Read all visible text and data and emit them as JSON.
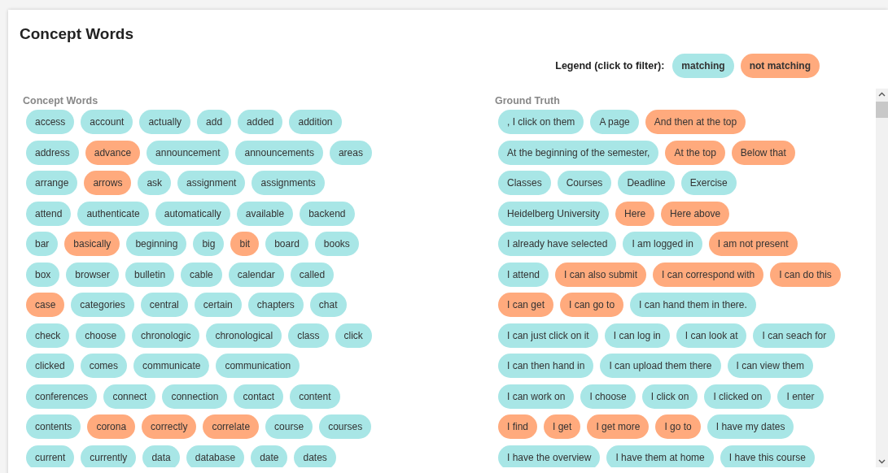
{
  "title": "Concept Words",
  "legend": {
    "label": "Legend (click to filter):",
    "items": [
      {
        "text": "matching",
        "matching": true
      },
      {
        "text": "not matching",
        "matching": false
      }
    ]
  },
  "panels": [
    {
      "heading": "Concept Words",
      "rows": [
        [
          {
            "text": "access",
            "matching": true
          },
          {
            "text": "account",
            "matching": true
          },
          {
            "text": "actually",
            "matching": true
          },
          {
            "text": "add",
            "matching": true
          },
          {
            "text": "added",
            "matching": true
          },
          {
            "text": "addition",
            "matching": true
          }
        ],
        [
          {
            "text": "address",
            "matching": true
          },
          {
            "text": "advance",
            "matching": false
          },
          {
            "text": "announcement",
            "matching": true
          },
          {
            "text": "announcements",
            "matching": true
          },
          {
            "text": "areas",
            "matching": true
          }
        ],
        [
          {
            "text": "arrange",
            "matching": true
          },
          {
            "text": "arrows",
            "matching": false
          },
          {
            "text": "ask",
            "matching": true
          },
          {
            "text": "assignment",
            "matching": true
          },
          {
            "text": "assignments",
            "matching": true
          }
        ],
        [
          {
            "text": "attend",
            "matching": true
          },
          {
            "text": "authenticate",
            "matching": true
          },
          {
            "text": "automatically",
            "matching": true
          },
          {
            "text": "available",
            "matching": true
          },
          {
            "text": "backend",
            "matching": true
          }
        ],
        [
          {
            "text": "bar",
            "matching": true
          },
          {
            "text": "basically",
            "matching": false
          },
          {
            "text": "beginning",
            "matching": true
          },
          {
            "text": "big",
            "matching": true
          },
          {
            "text": "bit",
            "matching": false
          },
          {
            "text": "board",
            "matching": true
          },
          {
            "text": "books",
            "matching": true
          }
        ],
        [
          {
            "text": "box",
            "matching": true
          },
          {
            "text": "browser",
            "matching": true
          },
          {
            "text": "bulletin",
            "matching": true
          },
          {
            "text": "cable",
            "matching": true
          },
          {
            "text": "calendar",
            "matching": true
          },
          {
            "text": "called",
            "matching": true
          }
        ],
        [
          {
            "text": "case",
            "matching": false
          },
          {
            "text": "categories",
            "matching": true
          },
          {
            "text": "central",
            "matching": true
          },
          {
            "text": "certain",
            "matching": true
          },
          {
            "text": "chapters",
            "matching": true
          },
          {
            "text": "chat",
            "matching": true
          }
        ],
        [
          {
            "text": "check",
            "matching": true
          },
          {
            "text": "choose",
            "matching": true
          },
          {
            "text": "chronologic",
            "matching": true
          },
          {
            "text": "chronological",
            "matching": true
          },
          {
            "text": "class",
            "matching": true
          },
          {
            "text": "click",
            "matching": true
          }
        ],
        [
          {
            "text": "clicked",
            "matching": true
          },
          {
            "text": "comes",
            "matching": true
          },
          {
            "text": "communicate",
            "matching": true
          },
          {
            "text": "communication",
            "matching": true
          }
        ],
        [
          {
            "text": "conferences",
            "matching": true
          },
          {
            "text": "connect",
            "matching": true
          },
          {
            "text": "connection",
            "matching": true
          },
          {
            "text": "contact",
            "matching": true
          },
          {
            "text": "content",
            "matching": true
          }
        ],
        [
          {
            "text": "contents",
            "matching": true
          },
          {
            "text": "corona",
            "matching": false
          },
          {
            "text": "correctly",
            "matching": false
          },
          {
            "text": "correlate",
            "matching": false
          },
          {
            "text": "course",
            "matching": true
          },
          {
            "text": "courses",
            "matching": true
          }
        ],
        [
          {
            "text": "current",
            "matching": true
          },
          {
            "text": "currently",
            "matching": true
          },
          {
            "text": "data",
            "matching": true
          },
          {
            "text": "database",
            "matching": true
          },
          {
            "text": "date",
            "matching": true
          },
          {
            "text": "dates",
            "matching": true
          }
        ]
      ]
    },
    {
      "heading": "Ground Truth",
      "scrollable": true,
      "rows": [
        [
          {
            "text": ", I click on them",
            "matching": true
          },
          {
            "text": "A page",
            "matching": true
          },
          {
            "text": "And then at the top",
            "matching": false
          }
        ],
        [
          {
            "text": "At the beginning of the semester,",
            "matching": true
          },
          {
            "text": "At the top",
            "matching": false
          },
          {
            "text": "Below that",
            "matching": false
          }
        ],
        [
          {
            "text": "Classes",
            "matching": true
          },
          {
            "text": "Courses",
            "matching": true
          },
          {
            "text": "Deadline",
            "matching": true
          },
          {
            "text": "Exercise",
            "matching": true
          }
        ],
        [
          {
            "text": "Heidelberg University",
            "matching": true
          },
          {
            "text": "Here",
            "matching": false
          },
          {
            "text": "Here above",
            "matching": false
          }
        ],
        [
          {
            "text": "I already have selected",
            "matching": true
          },
          {
            "text": "I am logged in",
            "matching": true
          },
          {
            "text": "I am not present",
            "matching": false
          }
        ],
        [
          {
            "text": "I attend",
            "matching": true
          },
          {
            "text": "I can also submit",
            "matching": false
          },
          {
            "text": "I can correspond with",
            "matching": false
          },
          {
            "text": "I can do this",
            "matching": false
          }
        ],
        [
          {
            "text": "I can get",
            "matching": false
          },
          {
            "text": "I can go to",
            "matching": false
          },
          {
            "text": "I can hand them in there.",
            "matching": true
          }
        ],
        [
          {
            "text": "I can just click on it",
            "matching": true
          },
          {
            "text": "I can log in",
            "matching": true
          },
          {
            "text": "I can look at",
            "matching": true
          },
          {
            "text": "I can seach for",
            "matching": true
          }
        ],
        [
          {
            "text": "I can then hand in",
            "matching": true
          },
          {
            "text": "I can upload them there",
            "matching": true
          },
          {
            "text": "I can view them",
            "matching": true
          }
        ],
        [
          {
            "text": "I can work on",
            "matching": true
          },
          {
            "text": "I choose",
            "matching": true
          },
          {
            "text": "I click on",
            "matching": true
          },
          {
            "text": "I clicked on",
            "matching": true
          },
          {
            "text": "I enter",
            "matching": true
          }
        ],
        [
          {
            "text": "I find",
            "matching": false
          },
          {
            "text": "I get",
            "matching": false
          },
          {
            "text": "I get more",
            "matching": false
          },
          {
            "text": "I go to",
            "matching": false
          },
          {
            "text": "I have my dates",
            "matching": true
          }
        ],
        [
          {
            "text": "I have the overview",
            "matching": true
          },
          {
            "text": "I have them at home",
            "matching": true
          },
          {
            "text": "I have this course",
            "matching": true
          }
        ]
      ]
    }
  ]
}
